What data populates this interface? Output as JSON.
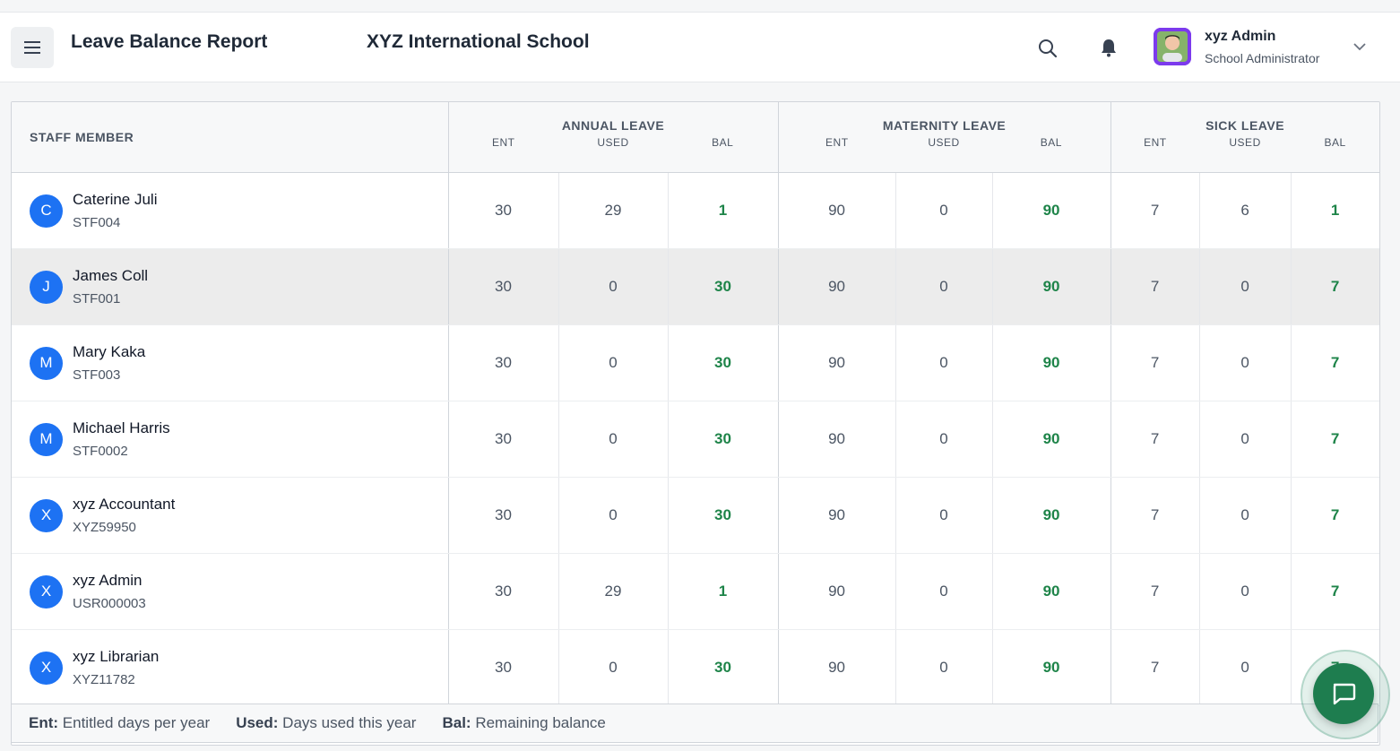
{
  "header": {
    "title": "Leave Balance Report",
    "school": "XYZ International School",
    "user": {
      "name": "xyz Admin",
      "role": "School Administrator"
    },
    "icons": [
      "menu-icon",
      "search-icon",
      "bell-icon",
      "chevron-down-icon"
    ]
  },
  "table": {
    "staff_header": "STAFF MEMBER",
    "groups": [
      "ANNUAL LEAVE",
      "MATERNITY LEAVE",
      "SICK LEAVE"
    ],
    "sub_headers": [
      "ENT",
      "USED",
      "BAL"
    ],
    "rows": [
      {
        "initial": "C",
        "name": "Caterine Juli",
        "id": "STF004",
        "vals": [
          "30",
          "29",
          "1",
          "90",
          "0",
          "90",
          "7",
          "6",
          "1"
        ]
      },
      {
        "initial": "J",
        "name": "James Coll",
        "id": "STF001",
        "vals": [
          "30",
          "0",
          "30",
          "90",
          "0",
          "90",
          "7",
          "0",
          "7"
        ]
      },
      {
        "initial": "M",
        "name": "Mary Kaka",
        "id": "STF003",
        "vals": [
          "30",
          "0",
          "30",
          "90",
          "0",
          "90",
          "7",
          "0",
          "7"
        ]
      },
      {
        "initial": "M",
        "name": "Michael Harris",
        "id": "STF0002",
        "vals": [
          "30",
          "0",
          "30",
          "90",
          "0",
          "90",
          "7",
          "0",
          "7"
        ]
      },
      {
        "initial": "X",
        "name": "xyz Accountant",
        "id": "XYZ59950",
        "vals": [
          "30",
          "0",
          "30",
          "90",
          "0",
          "90",
          "7",
          "0",
          "7"
        ]
      },
      {
        "initial": "X",
        "name": "xyz Admin",
        "id": "USR000003",
        "vals": [
          "30",
          "29",
          "1",
          "90",
          "0",
          "90",
          "7",
          "0",
          "7"
        ]
      },
      {
        "initial": "X",
        "name": "xyz Librarian",
        "id": "XYZ11782",
        "vals": [
          "30",
          "0",
          "30",
          "90",
          "0",
          "90",
          "7",
          "0",
          "7"
        ]
      }
    ]
  },
  "legend": [
    {
      "key": "Ent:",
      "text": "Entitled days per year"
    },
    {
      "key": "Used:",
      "text": "Days used this year"
    },
    {
      "key": "Bal:",
      "text": "Remaining balance"
    }
  ],
  "colors": {
    "accent": "#1d72f3",
    "balance": "#1e8449",
    "chat": "#1e7d4f"
  }
}
